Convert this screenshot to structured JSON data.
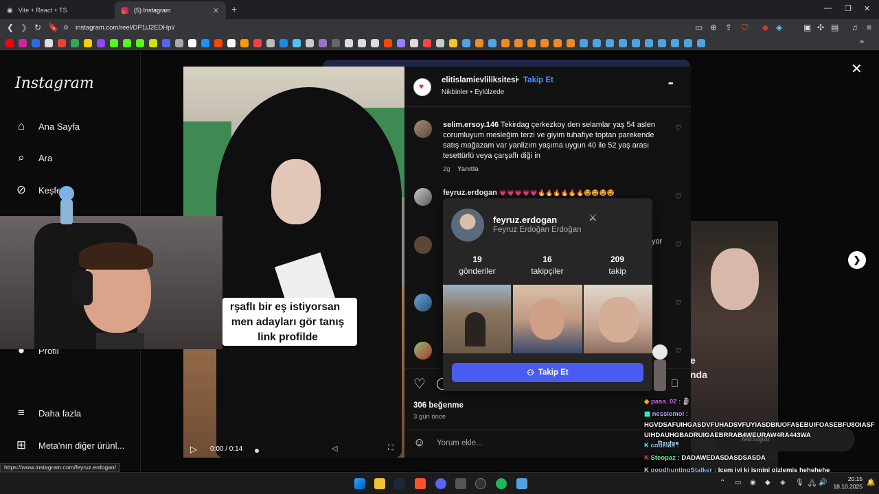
{
  "browser": {
    "tabs": [
      {
        "label": "Vite + React + TS"
      },
      {
        "label": "(5) Instagram"
      }
    ],
    "url": "instagram.com/reel/DP1iJ2EDHpl/",
    "status_url": "https://www.instagram.com/feyruz.erdogan/"
  },
  "sidebar": {
    "logo": "Instagram",
    "items": [
      {
        "label": "Ana Sayfa",
        "icon": "home-icon"
      },
      {
        "label": "Ara",
        "icon": "search-icon"
      },
      {
        "label": "Keşfet",
        "icon": "compass-icon"
      },
      {
        "label": "Profil",
        "icon": "profile-icon"
      },
      {
        "label": "Daha fazla",
        "icon": "menu-icon"
      },
      {
        "label": "Meta'nın diğer ürünl...",
        "icon": "grid-icon"
      }
    ]
  },
  "video": {
    "caption_lines": [
      "rşaflı bir eş istiyorsan",
      "men adayları gör tanış",
      "link profilde"
    ],
    "time": "0:00 / 0:14"
  },
  "post": {
    "author": "elitislamievliliksitesi",
    "dot": "•",
    "follow_label": "Takip Et",
    "audio": "Nikbinler • Eylülzede",
    "more": "•••",
    "comments": [
      {
        "user": "selim.ersoy.146",
        "text": "Tekirdag çerkezkoy den selamlar yaş 54 aslen corumluyum mesleğim terzi ve giyim tuhafiye toptan parekende satış mağazam var yanlizım yaşıma uygun 40 ile 52 yaş arası tesettürlü veya çarşaflı diği in",
        "time": "2g",
        "reply": "Yanıtla"
      },
      {
        "user": "feyruz.erdogan",
        "text": "💗💗💗💗💗🔥🔥🔥🔥🔥🔥🤩🤩🤩🤩"
      }
    ],
    "partial_text": "yor",
    "likes": "306 beğenme",
    "date": "3 gün önce",
    "comment_placeholder": "Yorum ekle..."
  },
  "popup": {
    "username": "feyruz.erdogan",
    "fullname": "Feyruz Erdoğan Erdoğan",
    "stats": [
      {
        "value": "19",
        "label": "gönderiler"
      },
      {
        "value": "16",
        "label": "takipçiler"
      },
      {
        "value": "209",
        "label": "takip"
      }
    ],
    "follow_button": "Takip Et"
  },
  "right_reel": {
    "text_lines": [
      "e",
      "nda"
    ],
    "messages": "Mesajlar"
  },
  "chat": [
    {
      "user": "pasa_02 :",
      "text": "",
      "color": "#d96bff"
    },
    {
      "user": "nessiemoi :",
      "text": "HGVDSAFUIHGASDVFUHADSVFUYIASDBIUOFASEBUIFOASEBFU8OIASFUIHDAUHGBADRUIGAEBRRAB4WEURAW4RA443WA",
      "color": "#b6a7ff"
    },
    {
      "user": "Paulas",
      "text": "",
      "color": "#ff6b9a"
    },
    {
      "user": "codelas :",
      "text": "",
      "color": "#7ec8ff"
    },
    {
      "user": "Steopaz :",
      "text": "DADAWEDASDASDSASDA",
      "color": "#52ff9a"
    },
    {
      "user": "goodhuntingStalker :",
      "text": "Icem iyi ki ismini gizlemiş hehehehe",
      "color": "#8ab4ff"
    }
  ],
  "taskbar": {
    "time": "20:15",
    "date": "18.10.2025"
  }
}
